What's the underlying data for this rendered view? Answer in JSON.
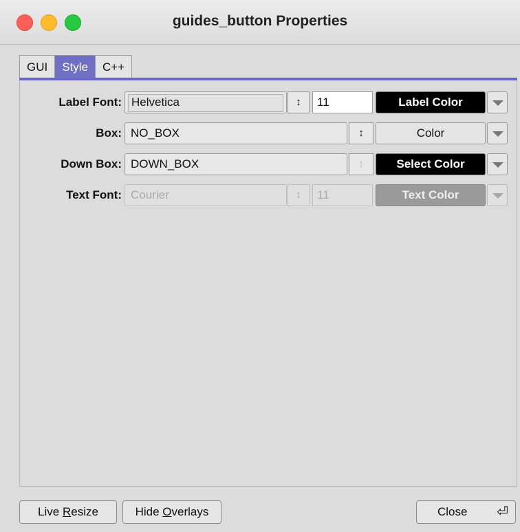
{
  "window": {
    "title": "guides_button Properties"
  },
  "tabs": [
    {
      "label": "GUI"
    },
    {
      "label": "Style"
    },
    {
      "label": "C++"
    }
  ],
  "rows": {
    "label_font": {
      "label": "Label Font:",
      "value": "Helvetica",
      "size": "11",
      "color_button": "Label Color"
    },
    "box": {
      "label": "Box:",
      "value": "NO_BOX",
      "color_button": "Color"
    },
    "down_box": {
      "label": "Down Box:",
      "value": "DOWN_BOX",
      "color_button": "Select Color"
    },
    "text_font": {
      "label": "Text Font:",
      "value": "Courier",
      "size": "11",
      "color_button": "Text Color"
    }
  },
  "footer": {
    "live_resize_pre": "Live ",
    "live_resize_ul": "R",
    "live_resize_post": "esize",
    "hide_overlays_pre": "Hide ",
    "hide_overlays_ul": "O",
    "hide_overlays_post": "verlays",
    "close": "Close"
  },
  "icons": {
    "spinner": "up-down-arrows",
    "dropdown": "chevron-down-icon",
    "enter": "return-key-icon"
  },
  "colors": {
    "accent": "#6868c2",
    "label_color": "#000000",
    "select_color": "#000000"
  }
}
